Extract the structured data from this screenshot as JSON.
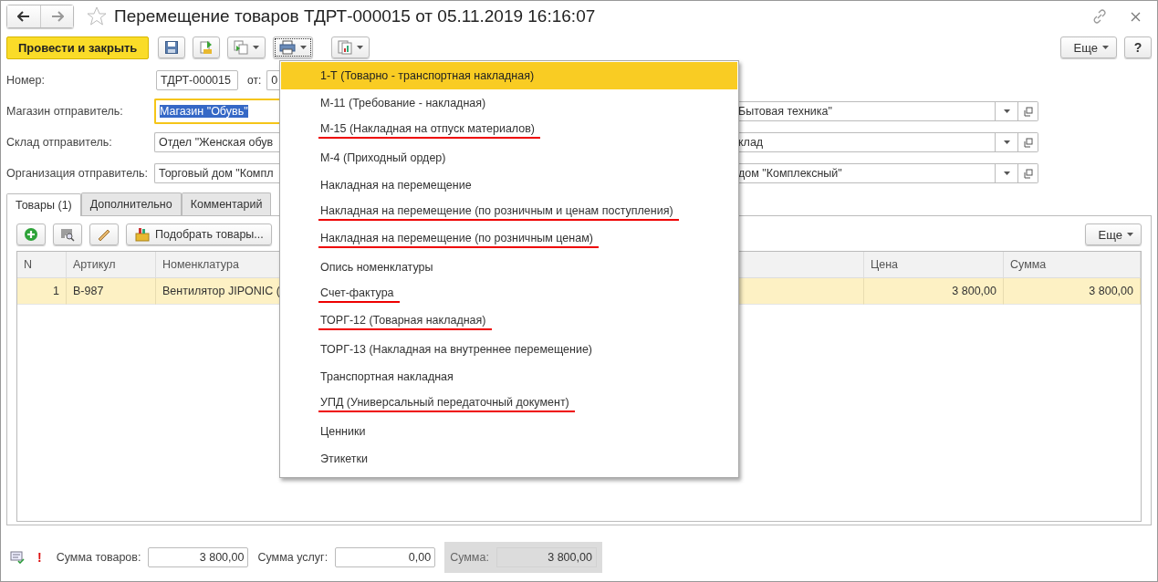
{
  "window": {
    "title": "Перемещение товаров ТДРТ-000015 от 05.11.2019 16:16:07"
  },
  "toolbar": {
    "post_button": "Провести и закрыть",
    "more_button": "Еще",
    "help_button": "?"
  },
  "number": {
    "label": "Номер:",
    "value": "ТДРТ-000015",
    "date_label": "от:",
    "date_value": "0"
  },
  "fields": [
    {
      "label": "Магазин отправитель:",
      "value": "Магазин \"Обувь\"",
      "focused": true,
      "right_value": "Бытовая техника\""
    },
    {
      "label": "Склад отправитель:",
      "value": "Отдел \"Женская обув",
      "focused": false,
      "right_value": "клад"
    },
    {
      "label": "Организация отправитель:",
      "value": "Торговый дом \"Компл",
      "focused": false,
      "right_value": "дом \"Комплексный\""
    }
  ],
  "tabs": [
    {
      "label": "Товары (1)",
      "selected": true
    },
    {
      "label": "Дополнительно",
      "selected": false
    },
    {
      "label": "Комментарий",
      "selected": false
    }
  ],
  "table_toolbar": {
    "pick_button": "Подобрать товары...",
    "more_button": "Еще"
  },
  "table": {
    "columns": [
      "N",
      "Артикул",
      "Номенклатура",
      "Цена",
      "Сумма"
    ],
    "rows": [
      {
        "cells": [
          "1",
          "В-987",
          "Вентилятор JIPONIC (",
          "3 800,00",
          "3 800,00"
        ],
        "selected": true
      }
    ]
  },
  "footer": {
    "warning": "!",
    "goods_label": "Сумма товаров:",
    "goods_value": "3 800,00",
    "services_label": "Сумма услуг:",
    "services_value": "0,00",
    "total_label": "Сумма:",
    "total_value": "3 800,00"
  },
  "print_menu": {
    "items": [
      {
        "label": "1-Т (Товарно - транспортная накладная)",
        "selected": true,
        "underlined": false
      },
      {
        "label": "М-11 (Требование -  накладная)",
        "selected": false,
        "underlined": false
      },
      {
        "label": "М-15 (Накладная на отпуск материалов)",
        "selected": false,
        "underlined": true
      },
      {
        "label": "М-4 (Приходный ордер)",
        "selected": false,
        "underlined": false
      },
      {
        "label": "Накладная на перемещение",
        "selected": false,
        "underlined": false
      },
      {
        "label": "Накладная на перемещение (по розничным и ценам поступления)",
        "selected": false,
        "underlined": true
      },
      {
        "label": "Накладная на перемещение (по розничным ценам)",
        "selected": false,
        "underlined": true
      },
      {
        "label": "Опись номенклатуры",
        "selected": false,
        "underlined": false
      },
      {
        "label": "Счет-фактура",
        "selected": false,
        "underlined": true
      },
      {
        "label": "ТОРГ-12 (Товарная накладная)",
        "selected": false,
        "underlined": true
      },
      {
        "label": "ТОРГ-13 (Накладная на внутреннее перемещение)",
        "selected": false,
        "underlined": false
      },
      {
        "label": "Транспортная накладная",
        "selected": false,
        "underlined": false
      },
      {
        "label": "УПД (Универсальный передаточный документ)",
        "selected": false,
        "underlined": true
      },
      {
        "label": "Ценники",
        "selected": false,
        "underlined": false
      },
      {
        "label": "Этикетки",
        "selected": false,
        "underlined": false
      }
    ]
  }
}
